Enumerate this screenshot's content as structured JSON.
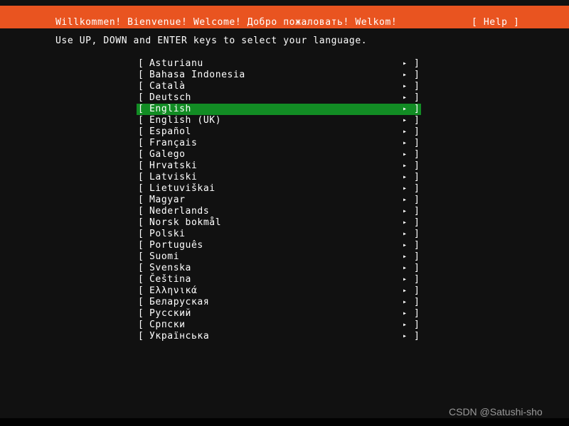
{
  "header": {
    "title": "Willkommen! Bienvenue! Welcome! Добро пожаловать! Welkom!",
    "help_label": "[ Help ]",
    "background_color": "#e95420",
    "text_color": "#ffffff"
  },
  "instruction": {
    "text": "Use UP, DOWN and ENTER keys to select your language."
  },
  "menu": {
    "bracket_open": "[",
    "bracket_close": "]",
    "arrow_icon": "▸",
    "selected_index": 4,
    "selected_value": "English",
    "highlight_color": "#128c24",
    "items": [
      {
        "label": "Asturianu"
      },
      {
        "label": "Bahasa Indonesia"
      },
      {
        "label": "Català"
      },
      {
        "label": "Deutsch"
      },
      {
        "label": "English"
      },
      {
        "label": "English (UK)"
      },
      {
        "label": "Español"
      },
      {
        "label": "Français"
      },
      {
        "label": "Galego"
      },
      {
        "label": "Hrvatski"
      },
      {
        "label": "Latviski"
      },
      {
        "label": "Lietuviškai"
      },
      {
        "label": "Magyar"
      },
      {
        "label": "Nederlands"
      },
      {
        "label": "Norsk bokmål"
      },
      {
        "label": "Polski"
      },
      {
        "label": "Português"
      },
      {
        "label": "Suomi"
      },
      {
        "label": "Svenska"
      },
      {
        "label": "Čeština"
      },
      {
        "label": "Ελληνικά"
      },
      {
        "label": "Беларуская"
      },
      {
        "label": "Русский"
      },
      {
        "label": "Српски"
      },
      {
        "label": "Українська"
      }
    ]
  },
  "watermark": {
    "text": "CSDN @Satushi-sho"
  },
  "screen": {
    "background_color": "#111111"
  }
}
